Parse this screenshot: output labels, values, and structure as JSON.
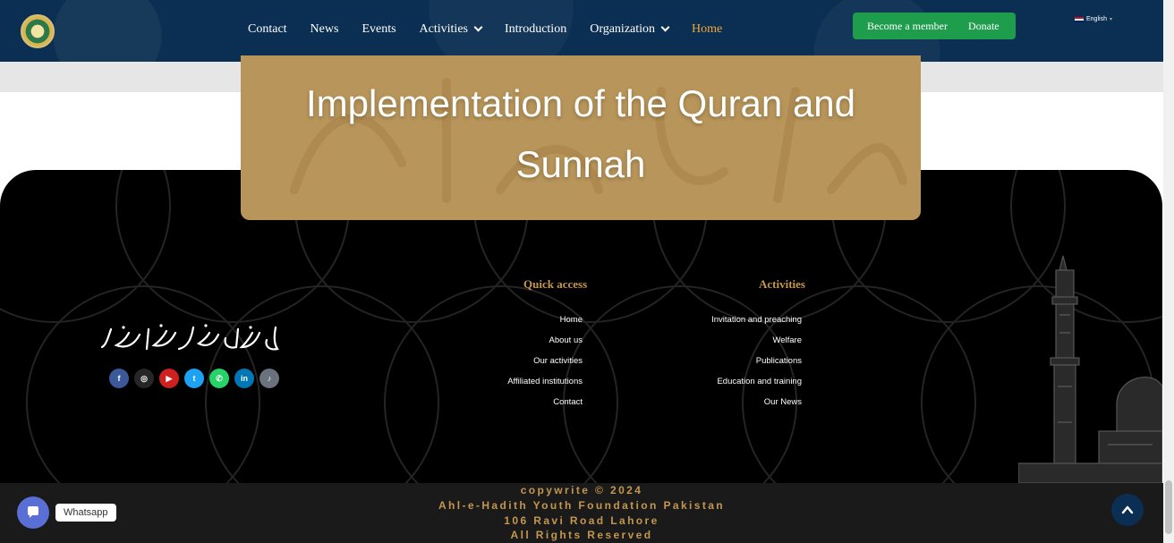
{
  "header": {
    "nav": [
      {
        "label": "Contact"
      },
      {
        "label": "News"
      },
      {
        "label": "Events"
      },
      {
        "label": "Activities",
        "dropdown": true
      },
      {
        "label": "Introduction"
      },
      {
        "label": "Organization",
        "dropdown": true
      },
      {
        "label": "Home",
        "active": true
      }
    ],
    "become_member": "Become a member",
    "donate": "Donate",
    "language": "English",
    "colors": {
      "bg": "#0b2f52",
      "cta": "#1e9d4c",
      "active": "#f2a63b"
    }
  },
  "hero": {
    "title_line1": "Implementation of the Quran and",
    "title_line2": "Sunnah",
    "color": "#b8955a"
  },
  "footer": {
    "socials": [
      {
        "icon": "facebook-icon",
        "glyph": "f",
        "color": "#3b5998"
      },
      {
        "icon": "instagram-icon",
        "glyph": "◎",
        "color": "#262626"
      },
      {
        "icon": "youtube-icon",
        "glyph": "▶",
        "color": "#cd201f"
      },
      {
        "icon": "twitter-icon",
        "glyph": "t",
        "color": "#1da1f2"
      },
      {
        "icon": "whatsapp-icon",
        "glyph": "✆",
        "color": "#25d366"
      },
      {
        "icon": "linkedin-icon",
        "glyph": "in",
        "color": "#0077b5"
      },
      {
        "icon": "tiktok-icon",
        "glyph": "♪",
        "color": "#69727d"
      }
    ],
    "quick_access": {
      "title": "Quick access",
      "links": [
        "Home",
        "About us",
        "Our activities",
        "Affiliated institutions",
        "Contact"
      ]
    },
    "activities": {
      "title": "Activities",
      "links": [
        "Invitation and preaching",
        "Welfare",
        "Publications",
        "Education and training",
        "Our News"
      ]
    },
    "accent": "#c4964f"
  },
  "bottom": {
    "copyright": "copywrite © 2024",
    "org": "Ahl-e-Hadith Youth Foundation Pakistan",
    "address": "106 Ravi Road Lahore",
    "rights": "All Rights Reserved"
  },
  "widgets": {
    "whatsapp_label": "Whatsapp"
  }
}
